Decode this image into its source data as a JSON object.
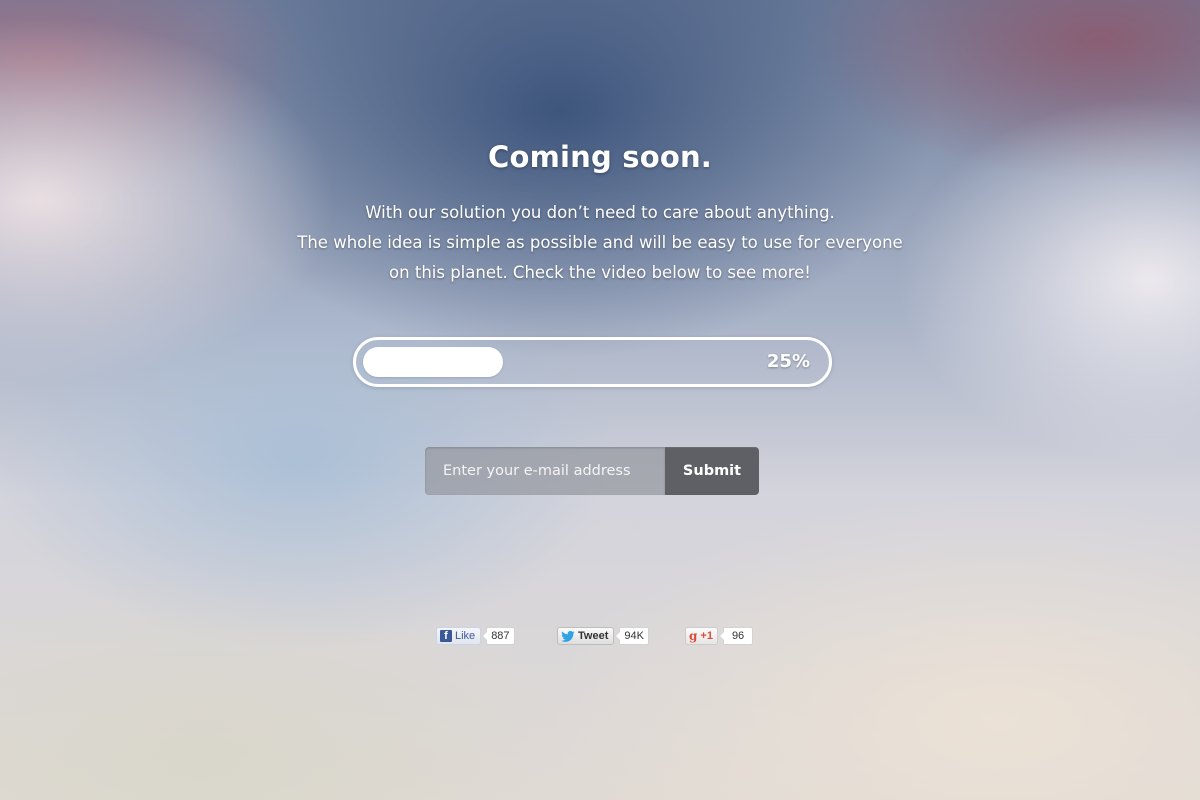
{
  "hero": {
    "title": "Coming soon.",
    "description_lines": [
      "With our solution you don’t need to care about anything.",
      "The whole idea is simple as possible and will be easy to use for everyone",
      "on this planet. Check the video below to see more!"
    ]
  },
  "progress": {
    "value_percent": 25,
    "label": "25%"
  },
  "signup": {
    "email_placeholder": "Enter your e-mail address",
    "email_value": "",
    "submit_label": "Submit"
  },
  "social": {
    "facebook": {
      "label": "Like",
      "count": "887",
      "icon": "facebook-icon",
      "color": "#3b5998"
    },
    "twitter": {
      "label": "Tweet",
      "count": "94K",
      "icon": "twitter-bird-icon",
      "color": "#2fa3e6"
    },
    "google_plus": {
      "label": "+1",
      "count": "96",
      "icon": "google-plus-icon",
      "color": "#dd4b39"
    }
  },
  "colors": {
    "text": "#ffffff",
    "submit_bg": "#5f6066",
    "input_bg": "#96989f"
  }
}
